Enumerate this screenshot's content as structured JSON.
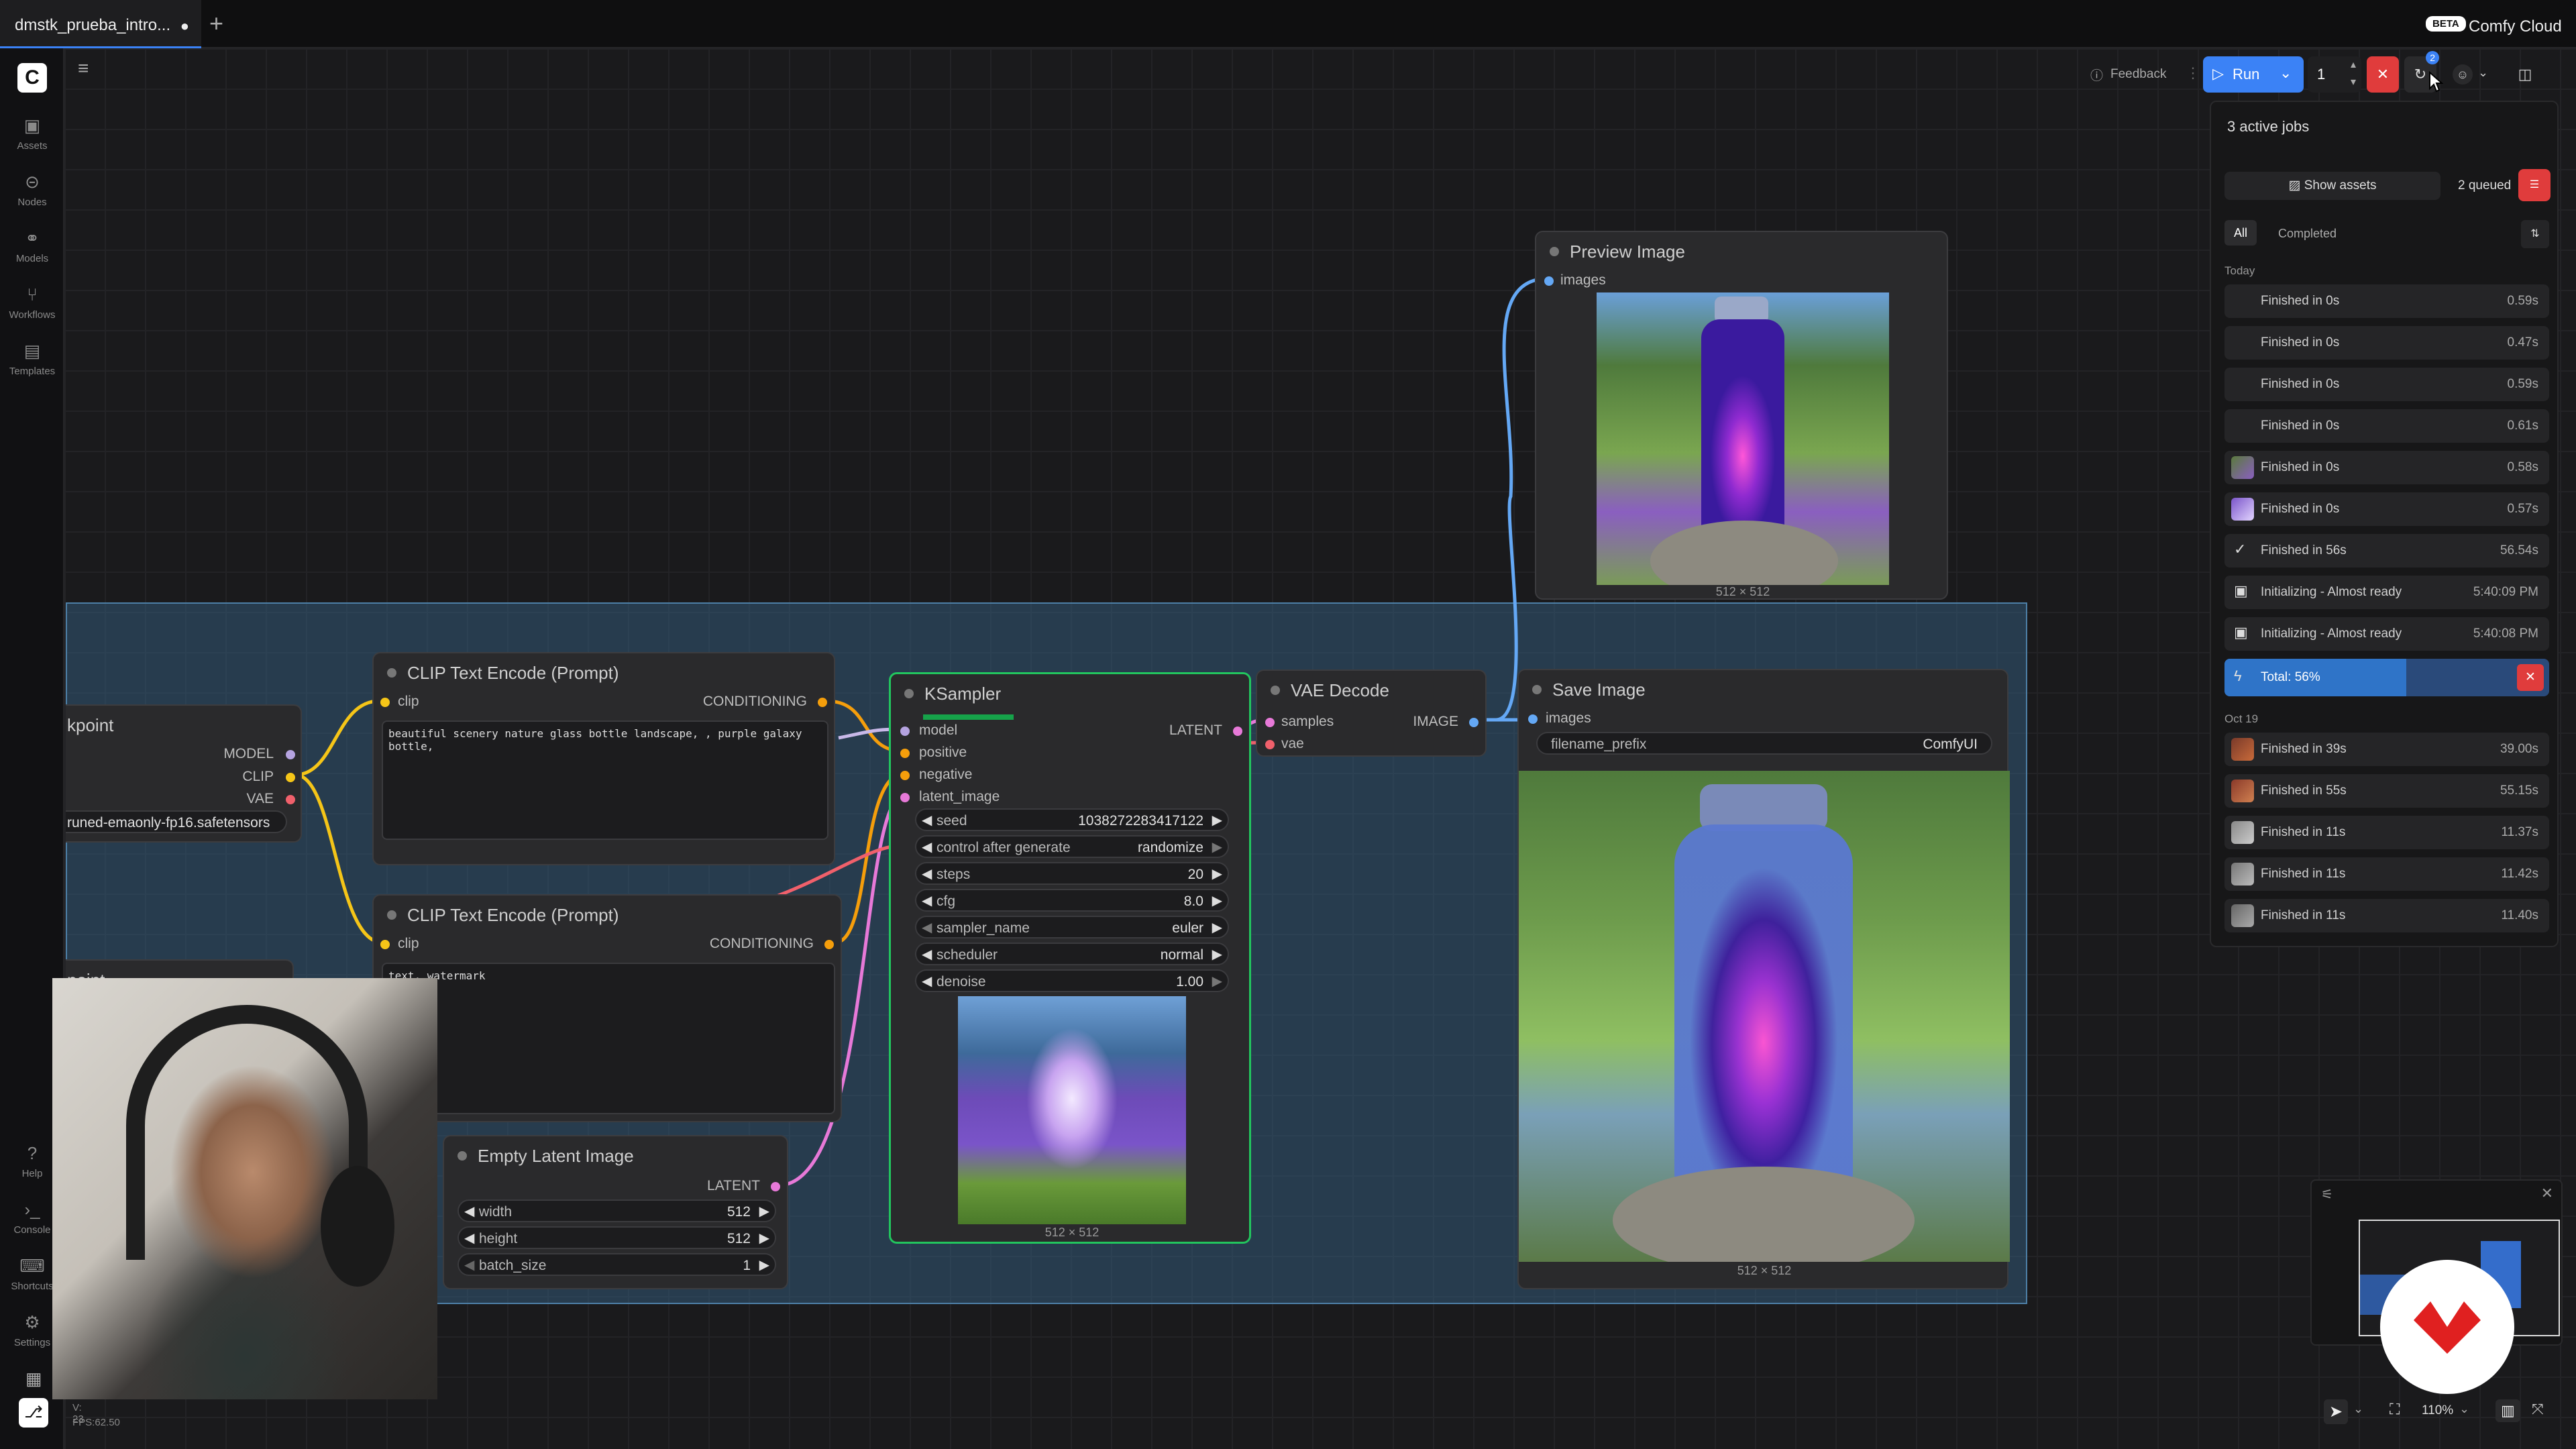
{
  "tab": {
    "title": "dmstk_prueba_intro...",
    "add": "+"
  },
  "brand": {
    "badge": "BETA",
    "name": "Comfy Cloud"
  },
  "sidebar": {
    "items": [
      {
        "label": "Assets",
        "icon": "assets-icon"
      },
      {
        "label": "Nodes",
        "icon": "nodes-icon"
      },
      {
        "label": "Models",
        "icon": "models-icon"
      },
      {
        "label": "Workflows",
        "icon": "workflows-icon"
      },
      {
        "label": "Templates",
        "icon": "templates-icon"
      }
    ],
    "bottom": [
      {
        "label": "Help"
      },
      {
        "label": "Console"
      },
      {
        "label": "Shortcuts"
      },
      {
        "label": "Settings"
      }
    ],
    "stats": {
      "v": "V: 23",
      "fps": "FPS:62.50"
    }
  },
  "toolbar": {
    "feedback": "Feedback",
    "run": "Run",
    "count": "1",
    "queue_badge": "2"
  },
  "queue": {
    "title": "3 active jobs",
    "show_assets": "Show assets",
    "queued": "2 queued",
    "tab_all": "All",
    "tab_completed": "Completed",
    "today_label": "Today",
    "today": [
      {
        "label": "Finished in 0s",
        "time": "0.59s"
      },
      {
        "label": "Finished in 0s",
        "time": "0.47s"
      },
      {
        "label": "Finished in 0s",
        "time": "0.59s"
      },
      {
        "label": "Finished in 0s",
        "time": "0.61s"
      },
      {
        "label": "Finished in 0s",
        "time": "0.58s"
      },
      {
        "label": "Finished in 0s",
        "time": "0.57s"
      },
      {
        "label": "Finished in 56s",
        "time": "56.54s"
      },
      {
        "label": "Initializing - Almost ready",
        "time": "5:40:09 PM"
      },
      {
        "label": "Initializing - Almost ready",
        "time": "5:40:08 PM"
      }
    ],
    "total": {
      "label": "Total: 56%",
      "progress": 0.56
    },
    "past_label": "Oct 19",
    "past": [
      {
        "label": "Finished in 39s",
        "time": "39.00s"
      },
      {
        "label": "Finished in 55s",
        "time": "55.15s"
      },
      {
        "label": "Finished in 11s",
        "time": "11.37s"
      },
      {
        "label": "Finished in 11s",
        "time": "11.42s"
      },
      {
        "label": "Finished in 11s",
        "time": "11.40s"
      }
    ]
  },
  "nodes": {
    "checkpoint": {
      "title": "kpoint",
      "outputs": [
        "MODEL",
        "CLIP",
        "VAE"
      ],
      "ckpt": "runed-emaonly-fp16.safetensors",
      "below": "point"
    },
    "clip1": {
      "title": "CLIP Text Encode (Prompt)",
      "in": "clip",
      "out": "CONDITIONING",
      "text": "beautiful scenery nature glass bottle landscape, , purple galaxy bottle,"
    },
    "clip2": {
      "title": "CLIP Text Encode (Prompt)",
      "in": "clip",
      "out": "CONDITIONING",
      "text": "text, watermark"
    },
    "latent": {
      "title": "Empty Latent Image",
      "out": "LATENT",
      "widgets": [
        {
          "label": "width",
          "value": "512"
        },
        {
          "label": "height",
          "value": "512"
        },
        {
          "label": "batch_size",
          "value": "1"
        }
      ]
    },
    "ksampler": {
      "title": "KSampler",
      "inputs": [
        "model",
        "positive",
        "negative",
        "latent_image"
      ],
      "out": "LATENT",
      "widgets": [
        {
          "label": "seed",
          "value": "1038272283417122"
        },
        {
          "label": "control after generate",
          "value": "randomize"
        },
        {
          "label": "steps",
          "value": "20"
        },
        {
          "label": "cfg",
          "value": "8.0"
        },
        {
          "label": "sampler_name",
          "value": "euler"
        },
        {
          "label": "scheduler",
          "value": "normal"
        },
        {
          "label": "denoise",
          "value": "1.00"
        }
      ],
      "size": "512 × 512",
      "progress": 0.45
    },
    "vae": {
      "title": "VAE Decode",
      "inputs": [
        "samples",
        "vae"
      ],
      "out": "IMAGE"
    },
    "save": {
      "title": "Save Image",
      "in": "images",
      "prefix_label": "filename_prefix",
      "prefix_value": "ComfyUI",
      "size": "512 × 512"
    },
    "preview": {
      "title": "Preview Image",
      "in": "images",
      "size": "512 × 512"
    }
  },
  "minimap": {
    "zoom": "110%"
  },
  "colors": {
    "accent": "#3b82f6",
    "danger": "#e03c3c",
    "ksampler_border": "#22c55e"
  }
}
